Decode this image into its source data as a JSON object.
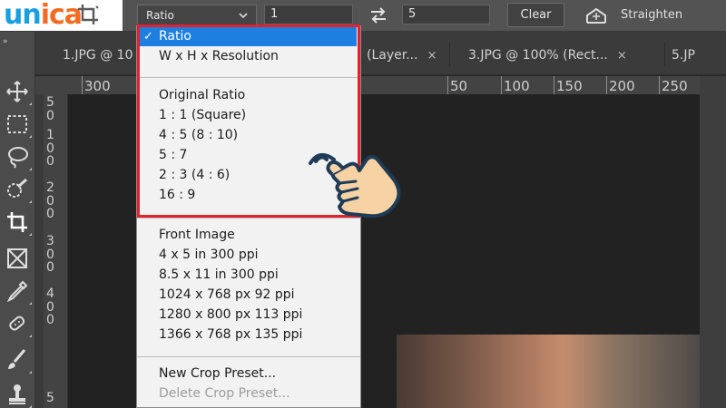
{
  "logo": {
    "text_part1": "un",
    "text_part2": "ica",
    "icon": "crop-tool-icon"
  },
  "options_bar": {
    "ratio_select": {
      "value": "Ratio",
      "icon": "chevron-down-icon"
    },
    "width_value": "1",
    "swap_icon": "swap-icon",
    "height_value": "5",
    "clear_label": "Clear",
    "straighten_icon": "straighten-icon",
    "straighten_label": "Straighten"
  },
  "tabs": [
    {
      "label": "1.JPG @ 10",
      "close": ""
    },
    {
      "label": "(Layer...",
      "close": "×"
    },
    {
      "label": "3.JPG @ 100% (Rect...",
      "close": "×"
    },
    {
      "label": "5.JP",
      "close": ""
    }
  ],
  "toolbar": {
    "collapse": "»",
    "tools": [
      "move-icon",
      "marquee-icon",
      "lasso-icon",
      "quick-select-icon",
      "crop-icon",
      "frame-icon",
      "eyedropper-icon",
      "healing-brush-icon",
      "brush-icon",
      "clone-stamp-icon"
    ]
  },
  "ruler_h": [
    "300",
    "50",
    "100",
    "150",
    "200",
    "250"
  ],
  "ruler_v": [
    "5",
    "0",
    "1",
    "0",
    "0",
    "2",
    "0",
    "0",
    "3",
    "0",
    "0",
    "4",
    "0",
    "0",
    "5"
  ],
  "dropdown": {
    "selected": "Ratio",
    "check": "✓",
    "group1": [
      "W x H x Resolution"
    ],
    "group2": [
      "Original Ratio",
      "1 : 1 (Square)",
      "4 : 5 (8 : 10)",
      "5 : 7",
      "2 : 3 (4 : 6)",
      "16 : 9"
    ],
    "group3": [
      "Front Image",
      "4 x 5 in 300 ppi",
      "8.5 x 11 in 300 ppi",
      "1024 x 768 px 92 ppi",
      "1280 x 800 px 113 ppi",
      "1366 x 768 px 135 ppi"
    ],
    "group4_enabled": "New Crop Preset...",
    "group4_disabled": "Delete Crop Preset..."
  },
  "colors": {
    "highlight": "#e0232e",
    "selection": "#1d7fe0",
    "logo_blue": "#1a9fe0",
    "logo_orange": "#f26b21"
  }
}
